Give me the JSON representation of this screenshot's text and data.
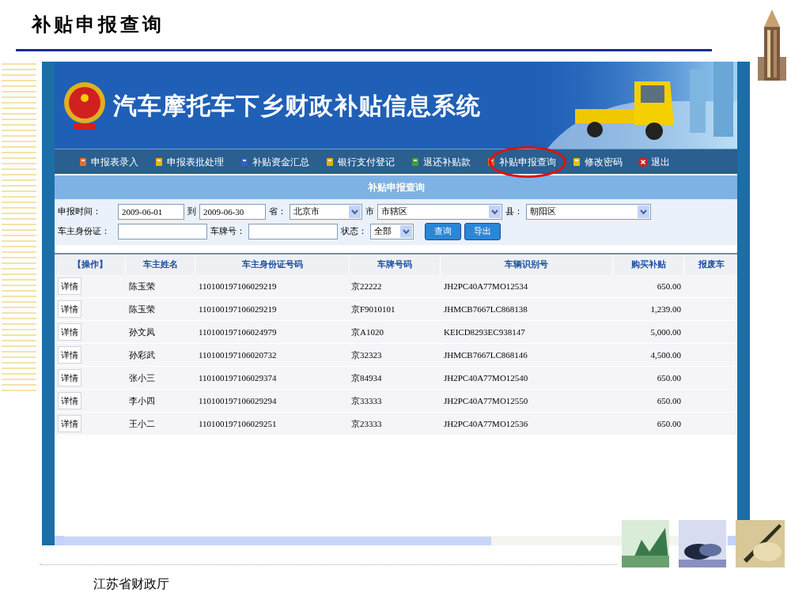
{
  "slide_title": "补贴申报查询",
  "banner": {
    "title": "汽车摩托车下乡财政补贴信息系统"
  },
  "nav": [
    {
      "label": "申报表录入",
      "circled": false
    },
    {
      "label": "申报表批处理",
      "circled": false
    },
    {
      "label": "补贴资金汇总",
      "circled": false
    },
    {
      "label": "银行支付登记",
      "circled": false
    },
    {
      "label": "退还补贴款",
      "circled": false
    },
    {
      "label": "补贴申报查询",
      "circled": true
    },
    {
      "label": "修改密码",
      "circled": false
    },
    {
      "label": "退出",
      "circled": false
    }
  ],
  "panel_title": "补贴申报查询",
  "filters": {
    "date_label": "申报时间：",
    "date_from": "2009-06-01",
    "to_label": "到",
    "date_to": "2009-06-30",
    "province_label": "省：",
    "province": "北京市",
    "city_label": "市",
    "city": "市辖区",
    "county_label": "县：",
    "county": "朝阳区",
    "id_label": "车主身份证：",
    "plate_label": "车牌号：",
    "status_label": "状态：",
    "status": "全部",
    "query_button": "查询",
    "export_button": "导出"
  },
  "table": {
    "columns": [
      "【操作】",
      "车主姓名",
      "车主身份证号码",
      "车牌号码",
      "车辆识别号",
      "购买补贴",
      "报废车"
    ],
    "rows": [
      {
        "action": "详情",
        "name": "陈玉荣",
        "id": "110100197106029219",
        "plate": "京22222",
        "vin": "JH2PC40A77MO12534",
        "subsidy": "650.00"
      },
      {
        "action": "详情",
        "name": "陈玉荣",
        "id": "110100197106029219",
        "plate": "京F9010101",
        "vin": "JHMCB7667LC868138",
        "subsidy": "1,239.00"
      },
      {
        "action": "详情",
        "name": "孙文凤",
        "id": "110100197106024979",
        "plate": "京A1020",
        "vin": "KEICD8293EC938147",
        "subsidy": "5,000.00"
      },
      {
        "action": "详情",
        "name": "孙彩武",
        "id": "110100197106020732",
        "plate": "京32323",
        "vin": "JHMCB7667LC868146",
        "subsidy": "4,500.00"
      },
      {
        "action": "详情",
        "name": "张小三",
        "id": "110100197106029374",
        "plate": "京84934",
        "vin": "JH2PC40A77MO12540",
        "subsidy": "650.00"
      },
      {
        "action": "详情",
        "name": "李小四",
        "id": "110100197106029294",
        "plate": "京33333",
        "vin": "JH2PC40A77MO12550",
        "subsidy": "650.00"
      },
      {
        "action": "详情",
        "name": "王小二",
        "id": "110100197106029251",
        "plate": "京23333",
        "vin": "JH2PC40A77MO12536",
        "subsidy": "650.00"
      }
    ]
  },
  "footer": "江苏省财政厅"
}
